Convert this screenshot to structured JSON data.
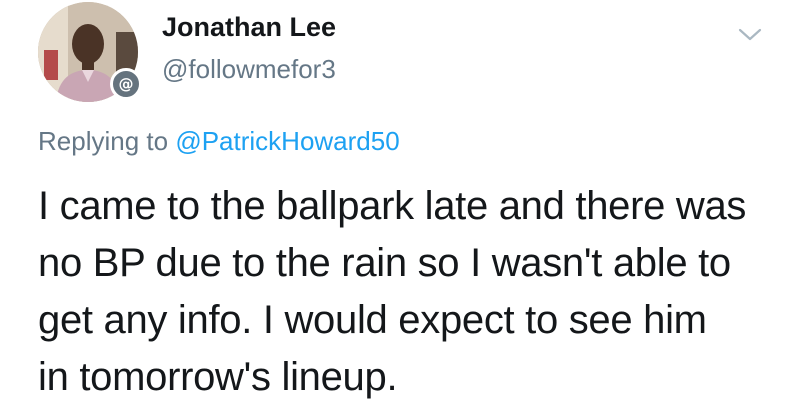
{
  "author": {
    "display_name": "Jonathan Lee",
    "handle": "@followmefor3",
    "badge_symbol": "@",
    "badge_color": "#65737e"
  },
  "reply": {
    "prefix": "Replying to",
    "target": "@PatrickHoward50",
    "link_color": "#1da1f2"
  },
  "tweet": {
    "text": "I came to the ballpark late and there was\nno BP due to the rain so I wasn't able to\nget any info.  I would expect to see him\nin tomorrow's lineup."
  },
  "icons": {
    "menu": "chevron-down-icon",
    "avatar": "user-avatar"
  }
}
